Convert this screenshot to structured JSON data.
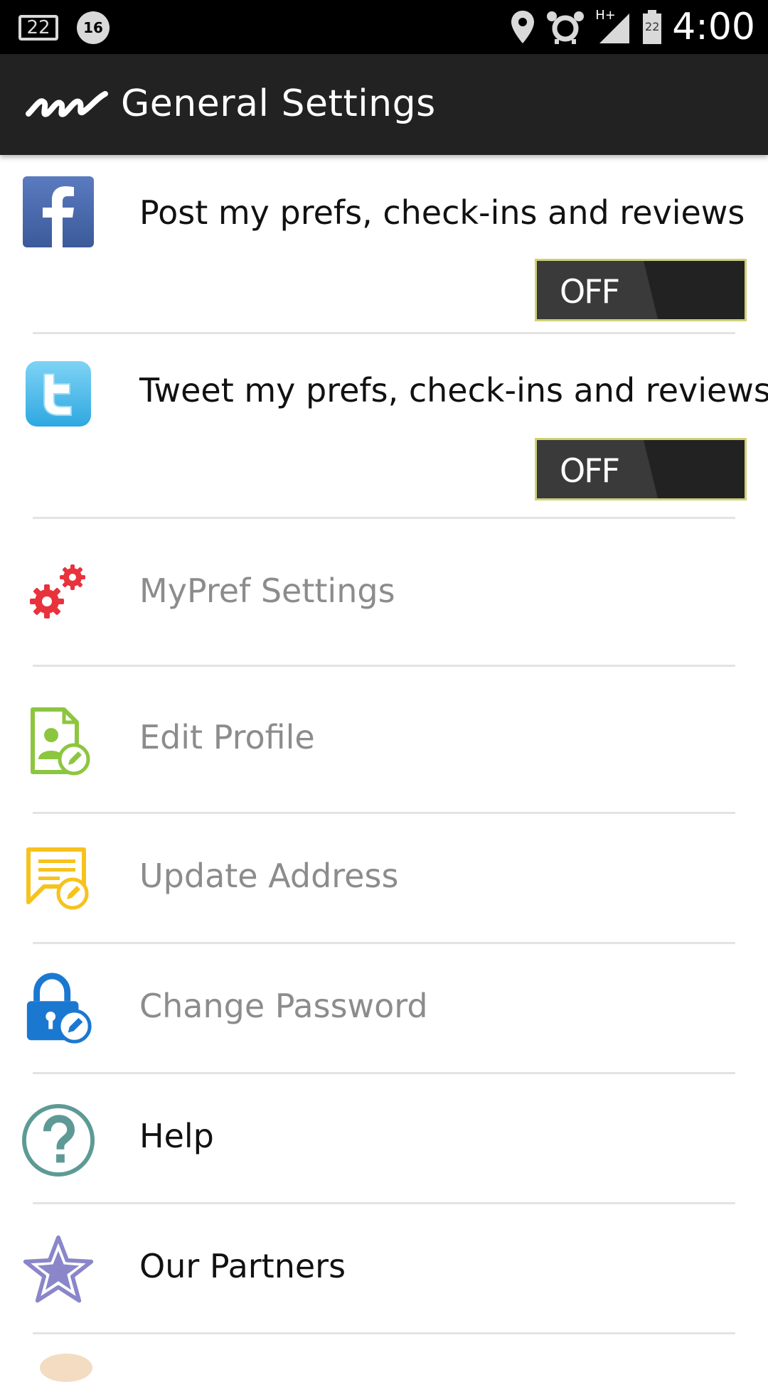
{
  "status_bar": {
    "notification_count": "22",
    "alarm_badge": "16",
    "network_label": "H+",
    "battery_level": "22",
    "time": "4:00"
  },
  "action_bar": {
    "title": "General Settings",
    "logo_icon": "mypref-logo-icon"
  },
  "social": [
    {
      "icon": "facebook-icon",
      "label": "Post my prefs, check-ins and reviews",
      "toggle": "OFF",
      "enabled": false
    },
    {
      "icon": "twitter-icon",
      "label": "Tweet my prefs, check-ins and reviews",
      "toggle": "OFF",
      "enabled": false
    }
  ],
  "menu": [
    {
      "icon": "gears-icon",
      "label": "MyPref Settings",
      "color": "#e8323c"
    },
    {
      "icon": "edit-profile-icon",
      "label": "Edit Profile",
      "color": "#8cc63f"
    },
    {
      "icon": "update-address-icon",
      "label": "Update Address",
      "color": "#f6c21c"
    },
    {
      "icon": "lock-edit-icon",
      "label": "Change Password",
      "color": "#1b78d1"
    },
    {
      "icon": "help-icon",
      "label": "Help",
      "color": "#5d9a96"
    },
    {
      "icon": "star-icon",
      "label": "Our Partners",
      "color": "#8a86c9"
    }
  ]
}
